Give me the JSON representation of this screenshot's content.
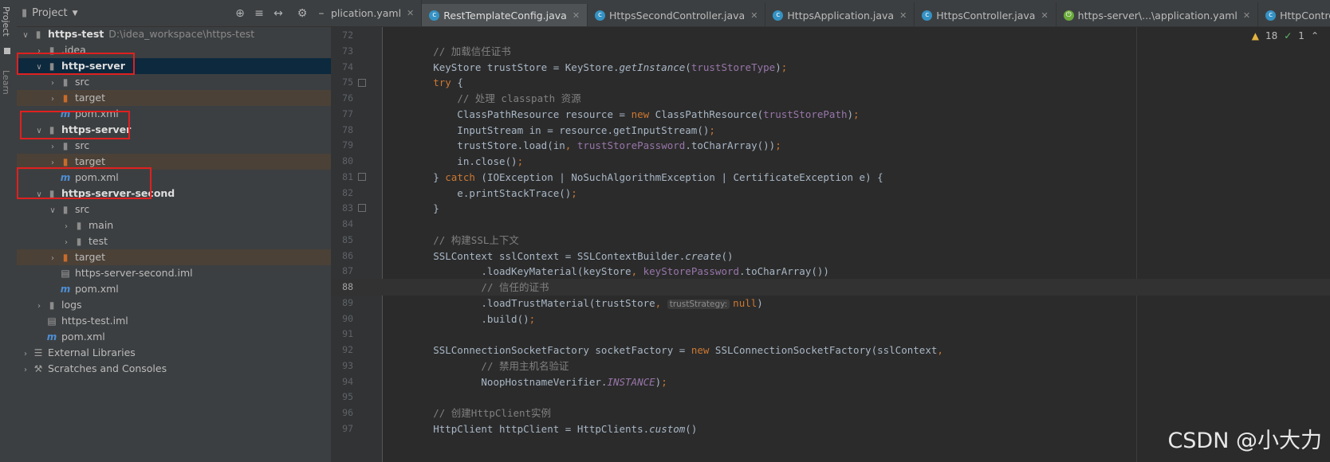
{
  "left_strip": {
    "project_label": "Project",
    "learn_label": "Learn"
  },
  "project_panel": {
    "title": "Project",
    "tools": [
      "locate-icon",
      "expand-icon",
      "collapse-icon",
      "gear-icon"
    ],
    "tree": [
      {
        "label": "https-test",
        "extra": "D:\\idea_workspace\\https-test",
        "depth": 0,
        "arrow": "open",
        "icon": "module",
        "bold": true
      },
      {
        "label": ".idea",
        "depth": 1,
        "arrow": "closed",
        "icon": "folder"
      },
      {
        "label": "http-server",
        "depth": 1,
        "arrow": "open",
        "icon": "module",
        "bold": true,
        "selected": true
      },
      {
        "label": "src",
        "depth": 2,
        "arrow": "closed",
        "icon": "folder"
      },
      {
        "label": "target",
        "depth": 2,
        "arrow": "closed",
        "icon": "folder-excluded",
        "excluded": true
      },
      {
        "label": "pom.xml",
        "depth": 2,
        "arrow": "none",
        "icon": "maven"
      },
      {
        "label": "https-server",
        "depth": 1,
        "arrow": "open",
        "icon": "module",
        "bold": true
      },
      {
        "label": "src",
        "depth": 2,
        "arrow": "closed",
        "icon": "folder"
      },
      {
        "label": "target",
        "depth": 2,
        "arrow": "closed",
        "icon": "folder-excluded",
        "excluded": true
      },
      {
        "label": "pom.xml",
        "depth": 2,
        "arrow": "none",
        "icon": "maven"
      },
      {
        "label": "https-server-second",
        "depth": 1,
        "arrow": "open",
        "icon": "module",
        "bold": true
      },
      {
        "label": "src",
        "depth": 2,
        "arrow": "open",
        "icon": "folder"
      },
      {
        "label": "main",
        "depth": 3,
        "arrow": "closed",
        "icon": "folder"
      },
      {
        "label": "test",
        "depth": 3,
        "arrow": "closed",
        "icon": "folder"
      },
      {
        "label": "target",
        "depth": 2,
        "arrow": "closed",
        "icon": "folder-excluded",
        "excluded": true
      },
      {
        "label": "https-server-second.iml",
        "depth": 2,
        "arrow": "none",
        "icon": "iml"
      },
      {
        "label": "pom.xml",
        "depth": 2,
        "arrow": "none",
        "icon": "maven"
      },
      {
        "label": "logs",
        "depth": 1,
        "arrow": "closed",
        "icon": "folder"
      },
      {
        "label": "https-test.iml",
        "depth": 1,
        "arrow": "none",
        "icon": "iml"
      },
      {
        "label": "pom.xml",
        "depth": 1,
        "arrow": "none",
        "icon": "maven"
      },
      {
        "label": "External Libraries",
        "depth": 0,
        "arrow": "closed",
        "icon": "libraries"
      },
      {
        "label": "Scratches and Consoles",
        "depth": 0,
        "arrow": "closed",
        "icon": "scratches"
      }
    ]
  },
  "tabs": [
    {
      "label": "plication.yaml",
      "icon": "none"
    },
    {
      "label": "RestTemplateConfig.java",
      "icon": "class",
      "active": true
    },
    {
      "label": "HttpsSecondController.java",
      "icon": "class"
    },
    {
      "label": "HttpsApplication.java",
      "icon": "class"
    },
    {
      "label": "HttpsController.java",
      "icon": "class"
    },
    {
      "label": "https-server\\...\\application.yaml",
      "icon": "spring"
    },
    {
      "label": "HttpController.java",
      "icon": "class"
    }
  ],
  "inspections": {
    "warnings": "18",
    "ok": "1"
  },
  "editor": {
    "current_line": "88",
    "lines": [
      {
        "n": "72",
        "html": ""
      },
      {
        "n": "73",
        "html": "        <span class=\"cm\">// 加载信任证书</span>"
      },
      {
        "n": "74",
        "html": "        KeyStore trustStore = KeyStore.<span class=\"it\">getInstance</span>(<span class=\"fld\">trustStoreType</span>)<span class=\"kw\">;</span>"
      },
      {
        "n": "75",
        "html": "        <span class=\"kw\">try</span> {"
      },
      {
        "n": "76",
        "html": "            <span class=\"cm\">// 处理 classpath 资源</span>"
      },
      {
        "n": "77",
        "html": "            ClassPathResource resource = <span class=\"kw\">new</span> ClassPathResource(<span class=\"fld\">trustStorePath</span>)<span class=\"kw\">;</span>"
      },
      {
        "n": "78",
        "html": "            InputStream in = resource.getInputStream()<span class=\"kw\">;</span>"
      },
      {
        "n": "79",
        "html": "            trustStore.load(in<span class=\"kw\">, </span><span class=\"fld\">trustStorePassword</span>.toCharArray())<span class=\"kw\">;</span>"
      },
      {
        "n": "80",
        "html": "            in.close()<span class=\"kw\">;</span>"
      },
      {
        "n": "81",
        "html": "        } <span class=\"kw\">catch</span> (IOException | NoSuchAlgorithmException | CertificateException e) {"
      },
      {
        "n": "82",
        "html": "            e.printStackTrace()<span class=\"kw\">;</span>"
      },
      {
        "n": "83",
        "html": "        }"
      },
      {
        "n": "84",
        "html": ""
      },
      {
        "n": "85",
        "html": "        <span class=\"cm\">// 构建SSL上下文</span>"
      },
      {
        "n": "86",
        "html": "        SSLContext sslContext = SSLContextBuilder.<span class=\"it\">create</span>()"
      },
      {
        "n": "87",
        "html": "                .loadKeyMaterial(keyStore<span class=\"kw\">, </span><span class=\"fld\">keyStorePassword</span>.toCharArray())"
      },
      {
        "n": "88",
        "html": "                <span class=\"cm\">// 信任的证书</span>"
      },
      {
        "n": "89",
        "html": "                .loadTrustMaterial(trustStore<span class=\"kw\">, </span><span class=\"hint\">trustStrategy:</span><span class=\"kw\">null</span>)"
      },
      {
        "n": "90",
        "html": "                .build()<span class=\"kw\">;</span>"
      },
      {
        "n": "91",
        "html": ""
      },
      {
        "n": "92",
        "html": "        SSLConnectionSocketFactory socketFactory = <span class=\"kw\">new</span> SSLConnectionSocketFactory(sslContext<span class=\"kw\">,</span>"
      },
      {
        "n": "93",
        "html": "                <span class=\"cm\">// 禁用主机名验证</span>"
      },
      {
        "n": "94",
        "html": "                NoopHostnameVerifier.<span class=\"fi\">INSTANCE</span>)<span class=\"kw\">;</span>"
      },
      {
        "n": "95",
        "html": ""
      },
      {
        "n": "96",
        "html": "        <span class=\"cm\">// 创建HttpClient实例</span>"
      },
      {
        "n": "97",
        "html": "        HttpClient httpClient = HttpClients.<span class=\"it\">custom</span>()"
      }
    ]
  },
  "watermark": "CSDN @小大力"
}
